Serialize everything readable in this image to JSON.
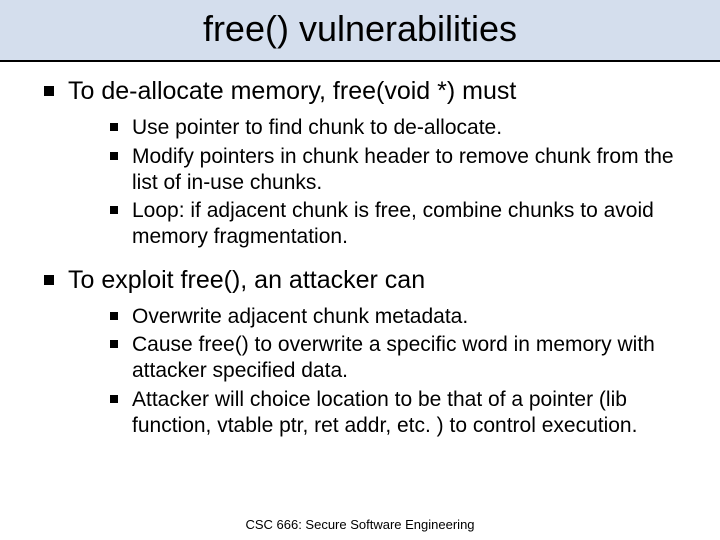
{
  "title": "free() vulnerabilities",
  "sections": [
    {
      "heading": "To de-allocate memory, free(void *) must",
      "items": [
        "Use pointer to find chunk to de-allocate.",
        "Modify pointers in chunk header to remove chunk from the list of in-use chunks.",
        "Loop: if adjacent chunk is free, combine chunks to avoid memory fragmentation."
      ]
    },
    {
      "heading": "To exploit free(), an attacker can",
      "items": [
        "Overwrite adjacent chunk metadata.",
        "Cause free() to overwrite a specific word in memory with attacker specified data.",
        "Attacker will choice location to be that of a pointer (lib function, vtable ptr, ret addr, etc. ) to control execution."
      ]
    }
  ],
  "footer": "CSC 666: Secure Software Engineering"
}
